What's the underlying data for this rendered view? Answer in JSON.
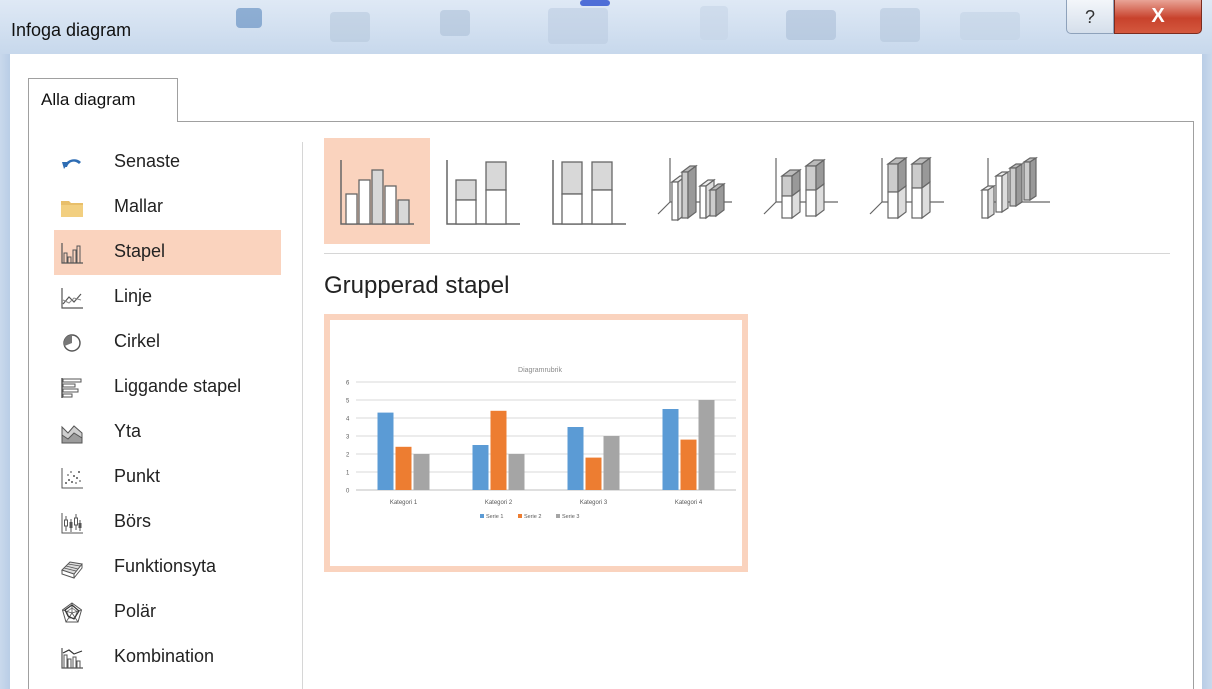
{
  "window": {
    "title": "Infoga diagram",
    "help_glyph": "?",
    "close_glyph": "X"
  },
  "tabs": [
    {
      "label": "Alla diagram",
      "active": true
    }
  ],
  "sidebar": {
    "items": [
      {
        "label": "Senaste",
        "icon": "recent-icon"
      },
      {
        "label": "Mallar",
        "icon": "folder-icon"
      },
      {
        "label": "Stapel",
        "icon": "column-chart-icon",
        "selected": true
      },
      {
        "label": "Linje",
        "icon": "line-chart-icon"
      },
      {
        "label": "Cirkel",
        "icon": "pie-chart-icon"
      },
      {
        "label": "Liggande stapel",
        "icon": "bar-chart-icon"
      },
      {
        "label": "Yta",
        "icon": "area-chart-icon"
      },
      {
        "label": "Punkt",
        "icon": "scatter-chart-icon"
      },
      {
        "label": "Börs",
        "icon": "stock-chart-icon"
      },
      {
        "label": "Funktionsyta",
        "icon": "surface-chart-icon"
      },
      {
        "label": "Polär",
        "icon": "radar-chart-icon"
      },
      {
        "label": "Kombination",
        "icon": "combo-chart-icon"
      }
    ]
  },
  "subtypes": {
    "items": [
      {
        "icon": "clustered-column-icon",
        "selected": true
      },
      {
        "icon": "stacked-column-icon"
      },
      {
        "icon": "100-stacked-column-icon"
      },
      {
        "icon": "3d-clustered-column-icon"
      },
      {
        "icon": "3d-stacked-column-icon"
      },
      {
        "icon": "3d-100-stacked-column-icon"
      },
      {
        "icon": "3d-column-icon"
      }
    ],
    "selected_title": "Grupperad stapel"
  },
  "colors": {
    "accent": "#fad3be",
    "series1": "#5b9bd5",
    "series2": "#ed7d31",
    "series3": "#a5a5a5"
  },
  "chart_data": {
    "type": "bar",
    "title": "Diagramrubrik",
    "categories": [
      "Kategori 1",
      "Kategori 2",
      "Kategori 3",
      "Kategori 4"
    ],
    "series": [
      {
        "name": "Serie 1",
        "values": [
          4.3,
          2.5,
          3.5,
          4.5
        ]
      },
      {
        "name": "Serie 2",
        "values": [
          2.4,
          4.4,
          1.8,
          2.8
        ]
      },
      {
        "name": "Serie 3",
        "values": [
          2,
          2,
          3,
          5
        ]
      }
    ],
    "ylim": [
      0,
      6
    ],
    "yticks": [
      "0",
      "1",
      "2",
      "3",
      "4",
      "5",
      "6"
    ],
    "grid": true,
    "legend": "bottom"
  }
}
